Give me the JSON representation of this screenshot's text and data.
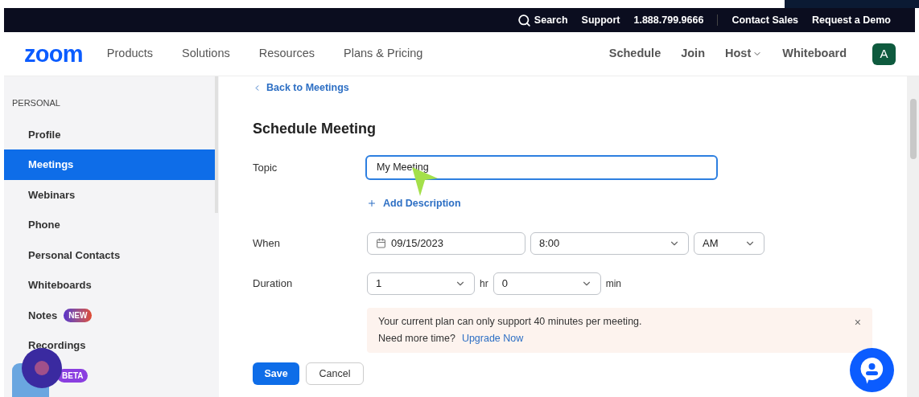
{
  "top_bar": {
    "links": [
      "Search",
      "Support",
      "1.888.799.9666",
      "Contact Sales",
      "Request a Demo"
    ]
  },
  "nav": {
    "logo": "zoom",
    "left_links": [
      "Products",
      "Solutions",
      "Resources",
      "Plans & Pricing"
    ],
    "right_links": [
      {
        "label": "Schedule",
        "kind": "link"
      },
      {
        "label": "Join",
        "kind": "link"
      },
      {
        "label": "Host",
        "kind": "menu"
      },
      {
        "label": "Whiteboard",
        "kind": "link"
      }
    ],
    "avatar": "A"
  },
  "sidebar": {
    "heading": "PERSONAL",
    "items": [
      {
        "label": "Profile",
        "selected": false
      },
      {
        "label": "Meetings",
        "selected": true
      },
      {
        "label": "Webinars",
        "selected": false
      },
      {
        "label": "Phone",
        "selected": false
      },
      {
        "label": "Personal Contacts",
        "selected": false
      },
      {
        "label": "Whiteboards",
        "selected": false
      },
      {
        "label": "Notes",
        "selected": false,
        "badge": "NEW"
      },
      {
        "label": "Recordings",
        "selected": false
      },
      {
        "selected": false,
        "badge": "BETA"
      }
    ]
  },
  "back_link": "Back to Meetings",
  "title": "Schedule Meeting",
  "topic": {
    "label": "Topic",
    "value": "My Meeting"
  },
  "add_description": "Add Description",
  "when": {
    "label": "When",
    "date": "09/15/2023",
    "time": "8:00",
    "ampm": "AM"
  },
  "duration": {
    "label": "Duration",
    "hours": "1",
    "hours_unit": "hr",
    "minutes": "0",
    "minutes_unit": "min"
  },
  "notice": {
    "text": "Your current plan can only support 40 minutes per meeting.",
    "question": "Need more time?",
    "link": "Upgrade Now",
    "close": "×"
  },
  "buttons": [
    {
      "label": "Save",
      "kind": "primary"
    },
    {
      "label": "Cancel",
      "kind": "secondary"
    }
  ]
}
